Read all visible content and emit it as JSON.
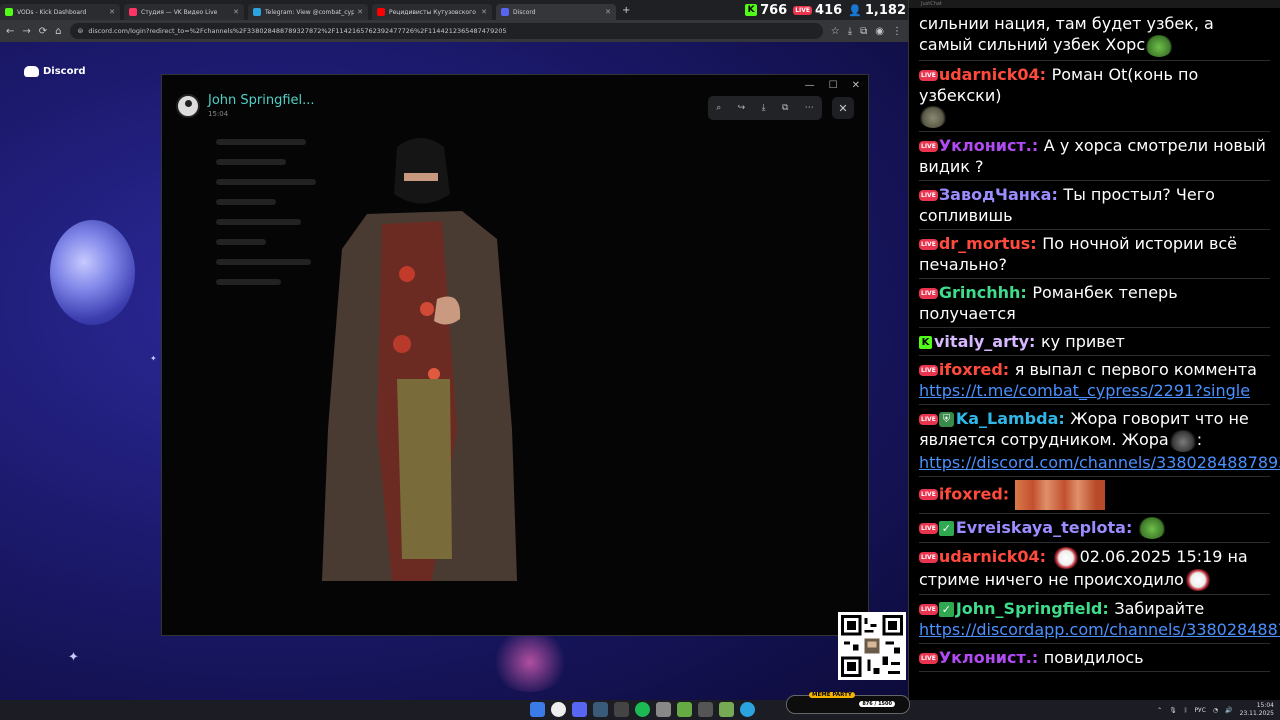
{
  "browser": {
    "tabs": [
      {
        "title": "VODs - Kick Dashboard",
        "fav_color": "#53fc18",
        "active": false
      },
      {
        "title": "Студия — VK Видео Live",
        "fav_color": "#ff3366",
        "active": false
      },
      {
        "title": "Telegram: View @combat_cypr",
        "fav_color": "#2aa3de",
        "active": false
      },
      {
        "title": "Рецидивисты Кутузовского пр...",
        "fav_color": "#ff0000",
        "active": false
      },
      {
        "title": "Discord",
        "fav_color": "#5865f2",
        "active": true
      }
    ],
    "url": "discord.com/login?redirect_to=%2Fchannels%2F338028488789327872%2F1142165762392477726%2F1144212365487479205"
  },
  "counters": {
    "kick": "766",
    "vk_badge": "LIVE",
    "vk": "416",
    "viewers": "1,182"
  },
  "discord": {
    "logo_text": "Discord",
    "viewer": {
      "author": "John Springfiel...",
      "time": "15:04"
    }
  },
  "chat": {
    "header": "JustChat",
    "messages": [
      {
        "type": "plain",
        "text": "сильнии нация, там будет узбек, а самый сильний узбек Хорс",
        "emote": "frog"
      },
      {
        "type": "msg",
        "badge": "live",
        "nick": "udarnick04",
        "color": "#ff4a3d",
        "text": "Роман Ot(конь по узбекски)",
        "emote": "rock"
      },
      {
        "type": "msg",
        "badge": "live",
        "nick": "Уклонист.",
        "color": "#b24bf3",
        "text": "А у хорса смотрели новый видик ?"
      },
      {
        "type": "msg",
        "badge": "live",
        "nick": "ЗаводЧанка",
        "color": "#9b8cff",
        "text": "Ты простыл? Чего сопливишь"
      },
      {
        "type": "msg",
        "badge": "live",
        "nick": "dr_mortus",
        "color": "#ff4a3d",
        "text": "По ночной истории всё печально?"
      },
      {
        "type": "msg",
        "badge": "live",
        "nick": "Grinchhh",
        "color": "#3fdc8c",
        "text": "Романбек теперь получается"
      },
      {
        "type": "msg",
        "badge": "kick",
        "nick": "vitaly_arty",
        "color": "#d8b8ff",
        "text": "ку привет"
      },
      {
        "type": "msg",
        "badge": "live",
        "nick": "ifoxred",
        "color": "#ff4a3d",
        "text": "я выпал с первого коммента",
        "link": "https://t.me/combat_cypress/2291?single"
      },
      {
        "type": "msg",
        "badge": "live",
        "badge2": "shield",
        "nick": "Ka_Lambda",
        "color": "#2fb7e8",
        "text": "Жора говорит что не является сотрудником. Жора",
        "emote": "rat",
        "text_after": ":",
        "link": "https://discord.com/channels/338028488789327872/114216576239..."
      },
      {
        "type": "msg",
        "badge": "live",
        "nick": "ifoxred",
        "color": "#ff4a3d",
        "text": "",
        "emote": "strip"
      },
      {
        "type": "msg",
        "badge": "live",
        "badge2": "check",
        "nick": "Evreiskaya_teplota",
        "color": "#9b8cff",
        "text": "",
        "emote": "frog"
      },
      {
        "type": "msg",
        "badge": "live",
        "nick": "udarnick04",
        "color": "#ff4a3d",
        "emote_before": "joker",
        "text": "02.06.2025 15:19 на стриме ничего не происходило",
        "emote": "joker"
      },
      {
        "type": "msg",
        "badge": "live",
        "badge2": "check",
        "nick": "John_Springfield",
        "color": "#3fdc8c",
        "text": "Забирайте",
        "link": "https://discordapp.com/channels/338028488789327872/114216576..."
      },
      {
        "type": "msg",
        "badge": "live",
        "nick": "Уклонист.",
        "color": "#b24bf3",
        "text": "повидилось"
      }
    ]
  },
  "widget": {
    "label": "MEME PARTY",
    "value": "876 / 1500"
  },
  "taskbar": {
    "lang": "РУС",
    "time": "15:04",
    "date": "23.11.2025"
  }
}
